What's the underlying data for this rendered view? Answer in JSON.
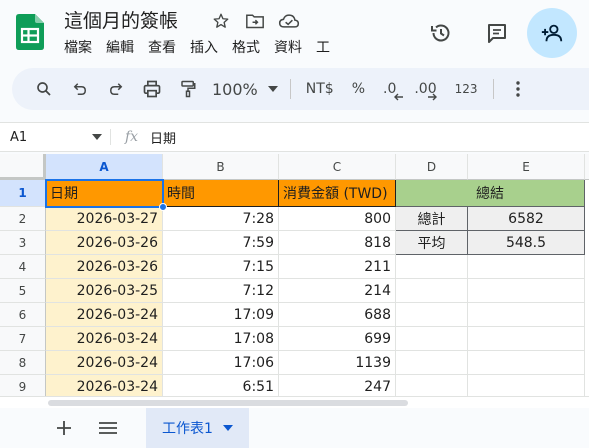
{
  "doc": {
    "title": "這個月的簽帳"
  },
  "menu": [
    "檔案",
    "編輯",
    "查看",
    "插入",
    "格式",
    "資料",
    "工"
  ],
  "toolbar": {
    "zoom": "100%",
    "currency": "NT$",
    "percent": "%",
    "dec_decrease": ".0",
    "dec_increase": ".00",
    "number_format": "123"
  },
  "formula_bar": {
    "cell_ref": "A1",
    "fx": "fx",
    "value": "日期"
  },
  "grid": {
    "columns": [
      "A",
      "B",
      "C",
      "D",
      "E"
    ],
    "rows": [
      "1",
      "2",
      "3",
      "4",
      "5",
      "6",
      "7",
      "8",
      "9"
    ],
    "headers": [
      "日期",
      "時間",
      "消費金額 (TWD)"
    ],
    "data": [
      [
        "2026-03-27",
        "7:28",
        "800"
      ],
      [
        "2026-03-26",
        "7:59",
        "818"
      ],
      [
        "2026-03-26",
        "7:15",
        "211"
      ],
      [
        "2026-03-25",
        "7:12",
        "214"
      ],
      [
        "2026-03-24",
        "17:09",
        "688"
      ],
      [
        "2026-03-24",
        "17:08",
        "699"
      ],
      [
        "2026-03-24",
        "17:06",
        "1139"
      ],
      [
        "2026-03-24",
        "6:51",
        "247"
      ]
    ],
    "summary": {
      "title": "總結",
      "rows": [
        {
          "label": "總計",
          "value": "6582"
        },
        {
          "label": "平均",
          "value": "548.5"
        }
      ]
    }
  },
  "sheets": {
    "active": "工作表1"
  },
  "colors": {
    "header_orange": "#ff9800",
    "date_fill": "#fef2cd",
    "summary_green": "#a8d08d",
    "summary_fill": "#efefef",
    "selection_blue": "#1a73e8",
    "share_bg": "#c2e7ff"
  }
}
